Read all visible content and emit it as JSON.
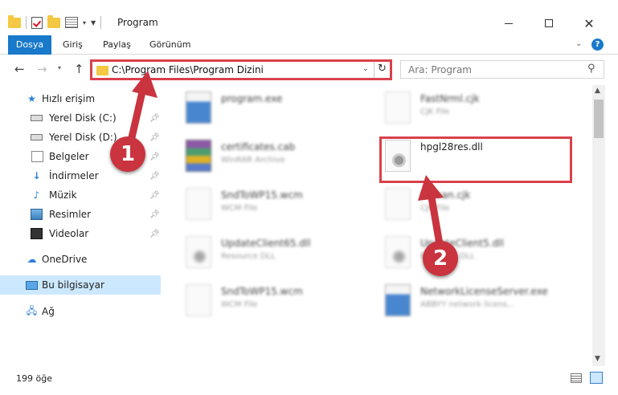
{
  "window": {
    "title": "Program",
    "min_glyph": "—",
    "max_glyph": "☐",
    "close_glyph": "✕"
  },
  "ribbon": {
    "file_tab": "Dosya",
    "tabs": [
      "Giriş",
      "Paylaş",
      "Görünüm"
    ]
  },
  "address": {
    "path": "C:\\Program Files\\Program Dizini"
  },
  "search": {
    "placeholder": "Ara: Program"
  },
  "sidebar": {
    "items": [
      {
        "label": "Hızlı erişim",
        "icon": "star-icon"
      },
      {
        "label": "Yerel Disk (C:)",
        "icon": "disk-icon"
      },
      {
        "label": "Yerel Disk (D:)",
        "icon": "disk-icon"
      },
      {
        "label": "Belgeler",
        "icon": "document-icon"
      },
      {
        "label": "İndirmeler",
        "icon": "download-icon"
      },
      {
        "label": "Müzik",
        "icon": "music-icon"
      },
      {
        "label": "Resimler",
        "icon": "pictures-icon"
      },
      {
        "label": "Videolar",
        "icon": "video-icon"
      },
      {
        "label": "OneDrive",
        "icon": "cloud-icon"
      },
      {
        "label": "Bu bilgisayar",
        "icon": "computer-icon"
      },
      {
        "label": "Ağ",
        "icon": "network-icon"
      }
    ]
  },
  "files": [
    {
      "name": "program.exe",
      "type": ""
    },
    {
      "name": "FastNrml.cjk",
      "type": "CJK File"
    },
    {
      "name": "certificates.cab",
      "type": "WinRAR Archive"
    },
    {
      "name": "hpgl28res.dll",
      "type": ""
    },
    {
      "name": "SndToWP15.wcm",
      "type": "WCM File"
    },
    {
      "name": "Korean.cjk",
      "type": "CJK File"
    },
    {
      "name": "UpdateClient65.dll",
      "type": "Resource DLL"
    },
    {
      "name": "UpdateClient5.dll",
      "type": "Resource DLL"
    },
    {
      "name": "SndToWP15.wcm",
      "type": "WCM File"
    },
    {
      "name": "NetworkLicenseServer.exe",
      "type": "ABBYY network licens..."
    }
  ],
  "status": {
    "count": "199 öğe"
  },
  "annotations": {
    "step1": "1",
    "step2": "2",
    "color": "#c9343f"
  }
}
